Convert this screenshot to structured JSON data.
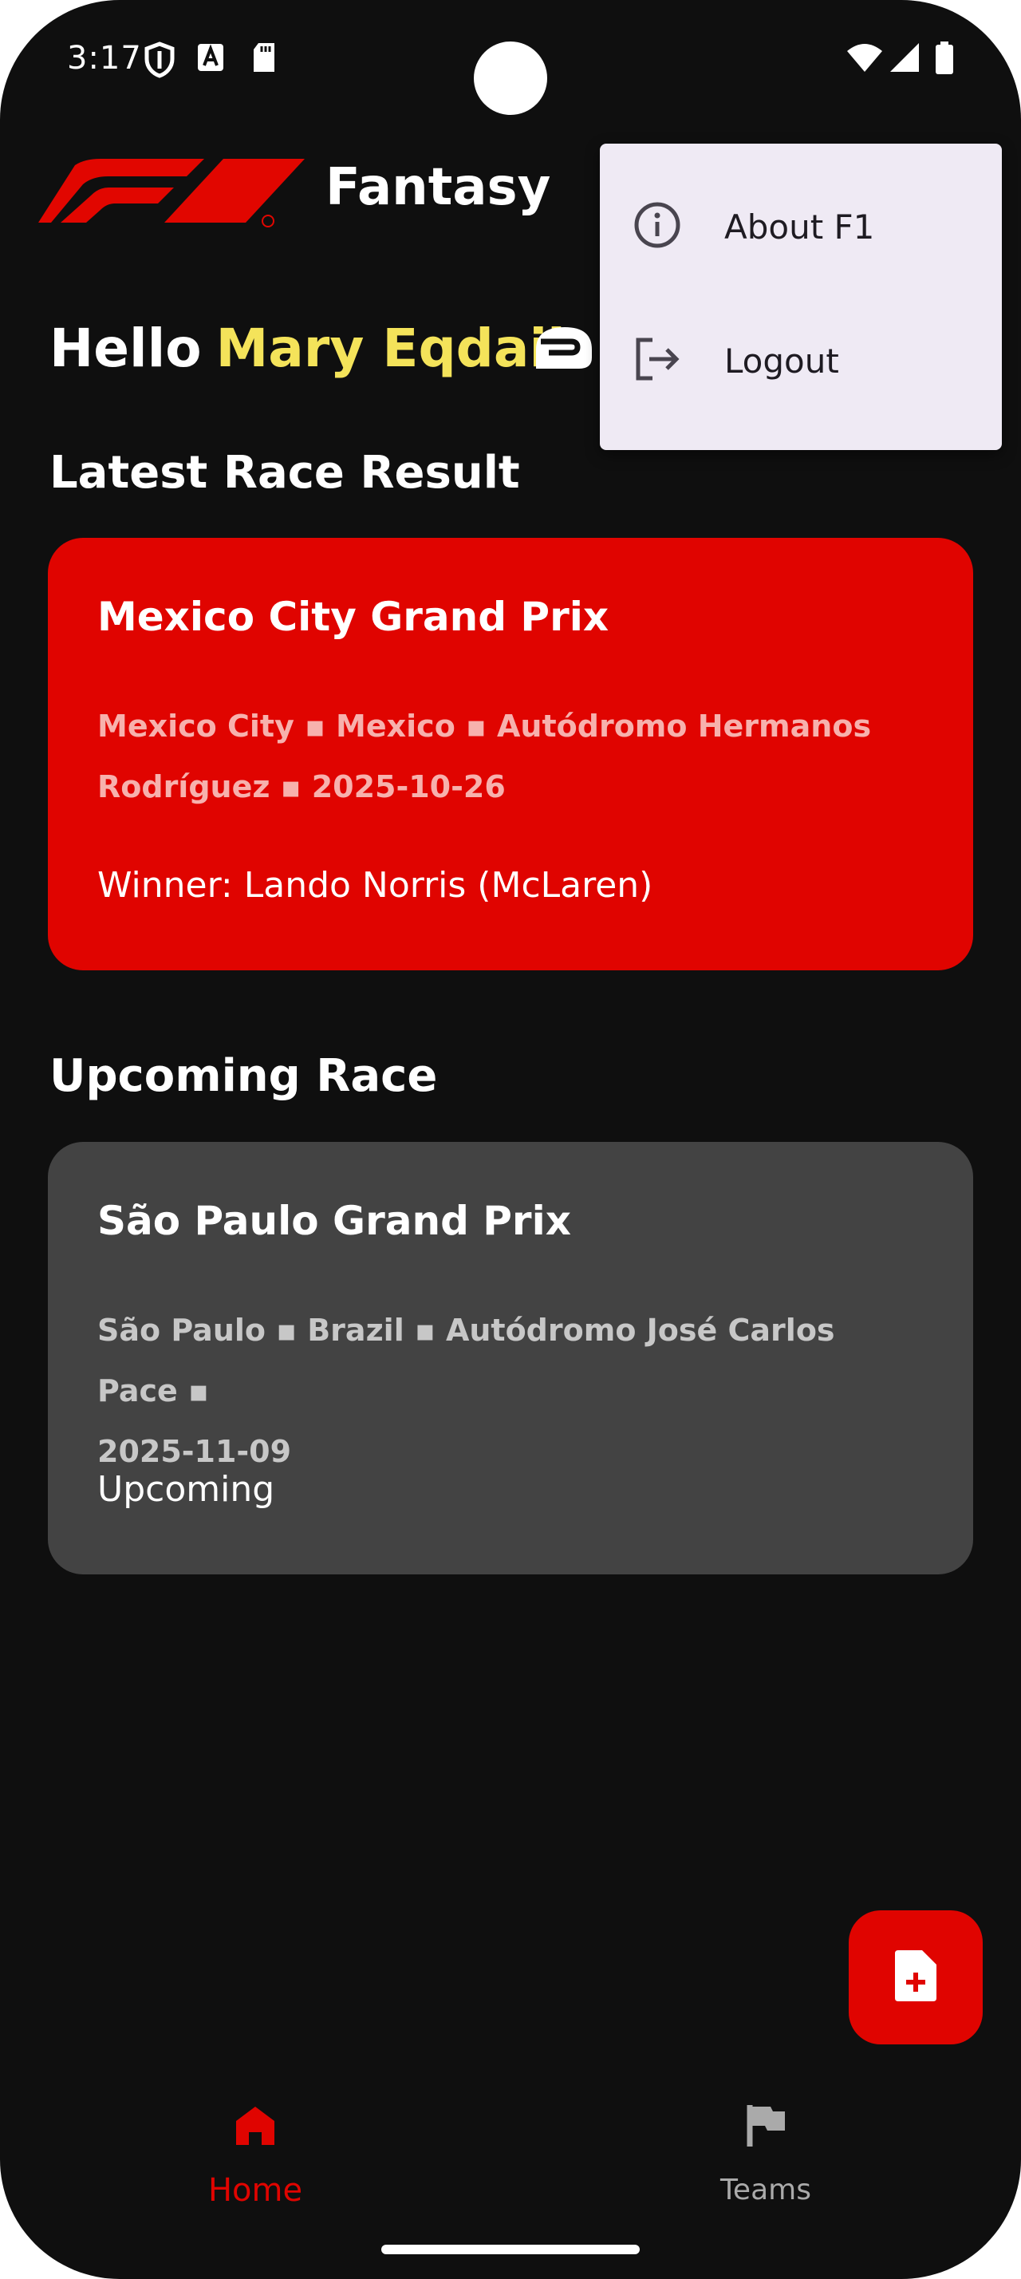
{
  "status_bar": {
    "time": "3:17"
  },
  "app_bar": {
    "title": "Fantasy"
  },
  "greeting": {
    "hello": "Hello",
    "user_name": "Mary Eqdaih"
  },
  "latest_race": {
    "section_title": "Latest Race Result",
    "race_name": "Mexico City Grand Prix",
    "meta_line1": "Mexico City ▪ Mexico ▪ Autódromo Hermanos",
    "meta_line2": "Rodríguez ▪ 2025-10-26",
    "status": "Winner: Lando Norris (McLaren)"
  },
  "upcoming_race": {
    "section_title": "Upcoming Race",
    "race_name": "São Paulo Grand Prix",
    "meta_line1": "São Paulo ▪ Brazil ▪ Autódromo José Carlos Pace ▪",
    "meta_line2": "2025-11-09",
    "status": "Upcoming"
  },
  "overflow_menu": {
    "items": [
      {
        "label": "About F1",
        "icon": "info-icon"
      },
      {
        "label": "Logout",
        "icon": "logout-icon"
      }
    ]
  },
  "bottom_nav": {
    "items": [
      {
        "label": "Home",
        "icon": "home-icon",
        "active": true
      },
      {
        "label": "Teams",
        "icon": "flag-icon",
        "active": false
      }
    ]
  },
  "colors": {
    "background": "#0f0f0f",
    "accent_red": "#e00400",
    "name_yellow": "#f4e35a",
    "upcoming_card": "#434343",
    "menu_background": "#efeaf4"
  }
}
